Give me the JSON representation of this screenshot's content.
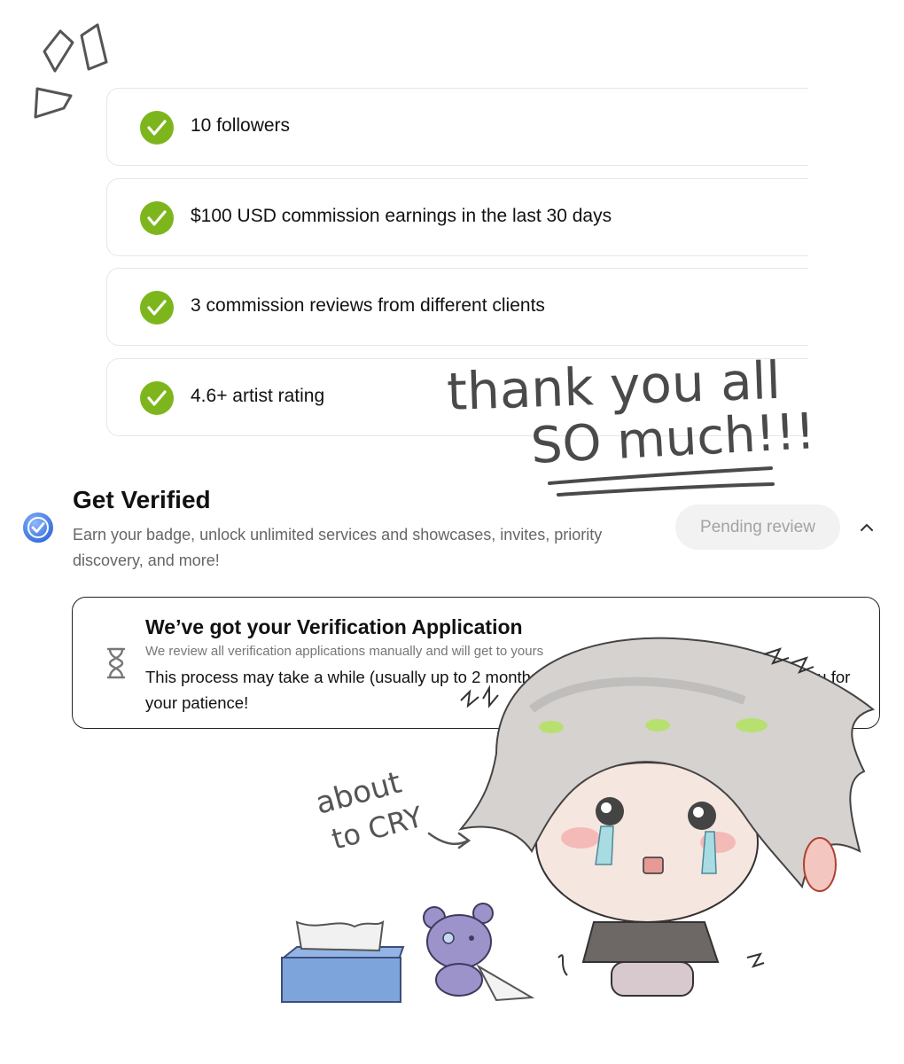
{
  "requirements": [
    {
      "label": "10 followers",
      "met": true
    },
    {
      "label": "$100 USD commission earnings in the last 30 days",
      "met": true
    },
    {
      "label": "3 commission reviews from different clients",
      "met": true
    },
    {
      "label": "4.6+ artist rating",
      "met": true
    }
  ],
  "get_verified": {
    "title": "Get Verified",
    "description": "Earn your badge, unlock unlimited services and showcases, invites, priority discovery, and more!",
    "status_button": "Pending review"
  },
  "application_notice": {
    "title": "We’ve got your Verification Application",
    "line1": "We review all verification applications manually and will get to yours",
    "line2": "This process may take a while (usually up to 2 months) - we'll notify you about this - thank you for your patience!"
  },
  "handwriting": {
    "thank_you_line1": "thank you all",
    "thank_you_line2": "SO much!!!",
    "about_to_cry_line1": "about",
    "about_to_cry_line2": "to CRY"
  },
  "colors": {
    "check_green": "#7db61c",
    "badge_blue": "#3b7de0",
    "pending_bg": "#f2f2f2",
    "pending_text": "#a3a3a3"
  }
}
